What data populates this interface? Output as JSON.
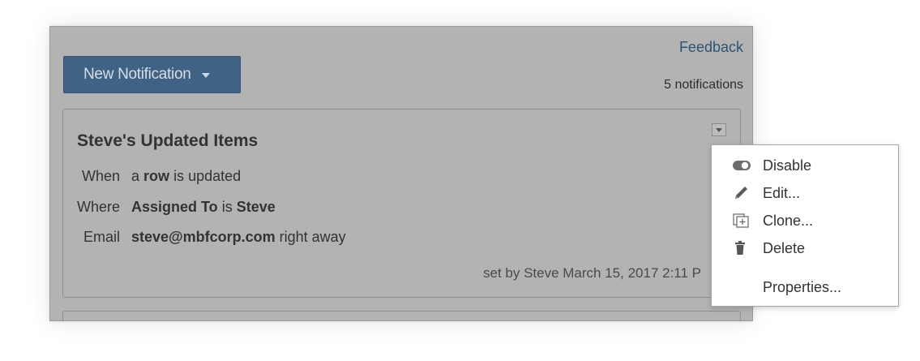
{
  "header": {
    "feedback_label": "Feedback",
    "new_button_label": "New Notification",
    "count_text": "5 notifications"
  },
  "notification": {
    "title": "Steve's Updated Items",
    "when_label": "When",
    "when_prefix": "a",
    "when_bold": "row",
    "when_suffix": "is updated",
    "where_label": "Where",
    "where_field": "Assigned To",
    "where_op": "is",
    "where_value": "Steve",
    "email_label": "Email",
    "email_address": "steve@mbfcorp.com",
    "email_timing": "right away",
    "meta": "set by Steve March 15, 2017 2:11 P"
  },
  "menu": {
    "items": [
      {
        "label": "Disable",
        "icon": "toggle-icon"
      },
      {
        "label": "Edit...",
        "icon": "pencil-icon"
      },
      {
        "label": "Clone...",
        "icon": "clone-icon"
      },
      {
        "label": "Delete",
        "icon": "trash-icon"
      },
      {
        "label": "Properties...",
        "icon": ""
      }
    ]
  },
  "colors": {
    "overlay": "#b3b3b3",
    "button": "#3f6285",
    "link": "#2f5375"
  }
}
